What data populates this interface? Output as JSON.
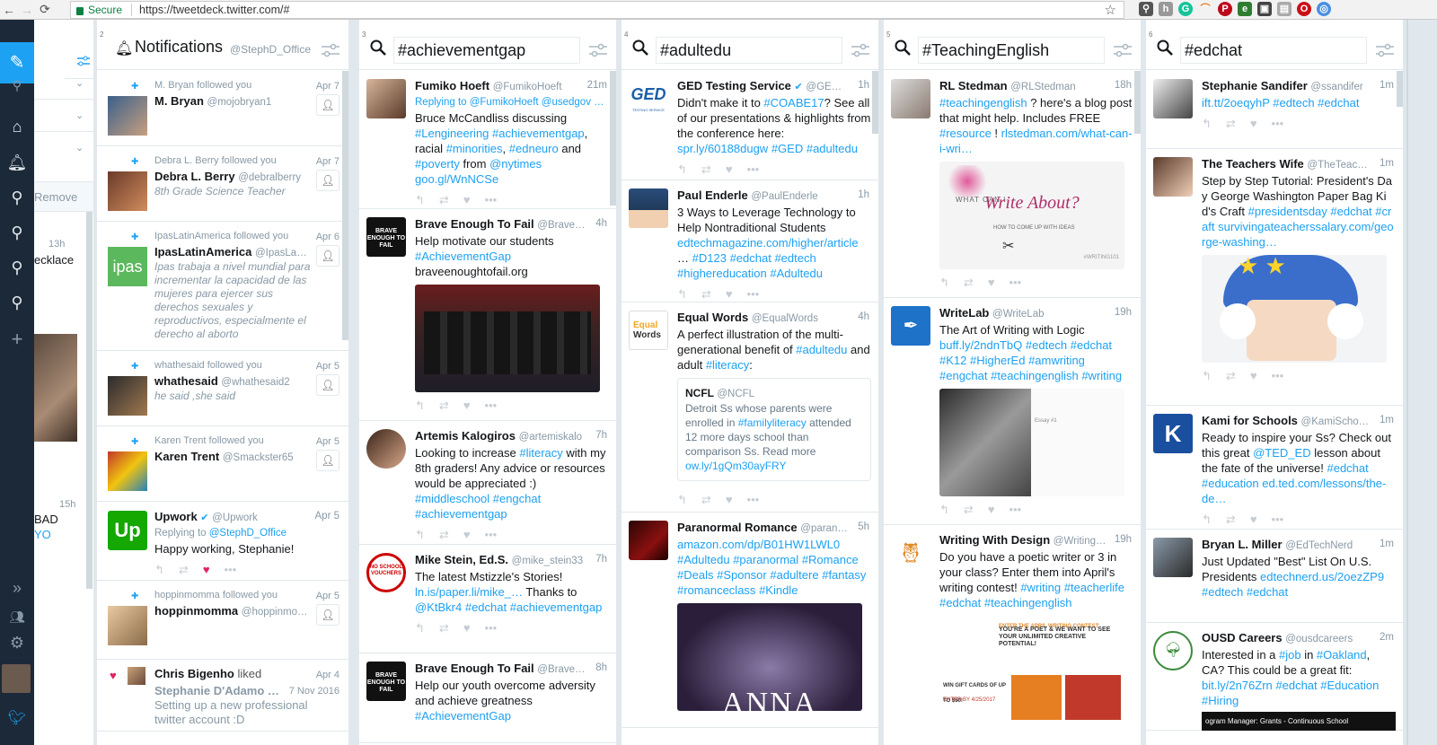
{
  "browser": {
    "secure_label": "Secure",
    "url": "https://tweetdeck.twitter.com/#"
  },
  "partial_column": {
    "lines": [
      "",
      "",
      ""
    ],
    "remove_label": "Remove",
    "time1": "13h",
    "snippet1": "ecklace",
    "time2": "15h",
    "snippet2": "BAD",
    "snippet3": "YO"
  },
  "columns": {
    "notifications": {
      "number": "2",
      "title": "Notifications",
      "account": "@StephD_Office",
      "items": [
        {
          "actor": "M. Bryan",
          "action": "followed you",
          "date": "Apr 7",
          "name": "M. Bryan",
          "handle": "@mojobryan1",
          "bio": ""
        },
        {
          "actor": "Debra L. Berry",
          "action": "followed you",
          "date": "Apr 7",
          "name": "Debra L. Berry",
          "handle": "@debralberry",
          "bio": "8th Grade Science Teacher"
        },
        {
          "actor": "IpasLatinAmerica",
          "action": "followed you",
          "date": "Apr 6",
          "name": "IpasLatinAmerica",
          "handle": "@IpasLa…",
          "bio": "Ipas trabaja a nivel mundial para incrementar la capacidad de las mujeres para ejercer sus derechos sexuales y reproductivos, especialmente el derecho al aborto"
        },
        {
          "actor": "whathesaid",
          "action": "followed you",
          "date": "Apr 5",
          "name": "whathesaid",
          "handle": "@whathesaid2",
          "bio": "he said ,she said"
        },
        {
          "actor": "Karen Trent",
          "action": "followed you",
          "date": "Apr 5",
          "name": "Karen Trent",
          "handle": "@Smackster65",
          "bio": ""
        }
      ],
      "upwork": {
        "name": "Upwork",
        "handle": "@Upwork",
        "date": "Apr 5",
        "reply_prefix": "Replying to",
        "reply_to": "@StephD_Office",
        "text": "Happy working, Stephanie!"
      },
      "hoppin": {
        "actor": "hoppinmomma",
        "action": "followed you",
        "date": "Apr 5",
        "name": "hoppinmomma",
        "handle": "@hoppinmo…"
      },
      "liked": {
        "actor": "Chris Bigenho",
        "action": "liked",
        "date": "Apr 4",
        "name": "Stephanie D'Adamo …",
        "date2": "7 Nov 2016",
        "text": "Setting up a new professional twitter account :D"
      }
    },
    "achievementgap": {
      "number": "3",
      "query": "#achievementgap",
      "tweets": [
        {
          "name": "Fumiko Hoeft",
          "handle": "@FumikoHoeft",
          "time": "21m",
          "reply": "Replying to @FumikoHoeft @usedgov …",
          "text": "Bruce McCandliss discussing #Lengineering #achievementgap, racial #minorities, #edneuro and #poverty from @nytimes goo.gl/WnNCSe"
        },
        {
          "name": "Brave Enough To Fail",
          "handle": "@Brave…",
          "time": "4h",
          "text": "Help motivate our students #AchievementGap braveenoughtofail.org"
        },
        {
          "name": "Artemis Kalogiros",
          "handle": "@artemiskalo",
          "time": "7h",
          "text": "Looking to increase #literacy with my 8th graders! Any advice or resources would be appreciated :) #middleschool #engchat #achievementgap"
        },
        {
          "name": "Mike Stein, Ed.S.",
          "handle": "@mike_stein33",
          "time": "7h",
          "text": "The latest Mstizzle's Stories! ln.is/paper.li/mike_… Thanks to @KtBkr4 #edchat #achievementgap"
        },
        {
          "name": "Brave Enough To Fail",
          "handle": "@Brave…",
          "time": "8h",
          "text": "Help our youth overcome adversity and achieve greatness #AchievementGap"
        }
      ],
      "brave_logo": "BRAVE ENOUGH TO FAIL",
      "nsv_logo": "NO SCHOOL VOUCHERS"
    },
    "adultedu": {
      "number": "4",
      "query": "#adultedu",
      "tweets": [
        {
          "name": "GED Testing Service",
          "handle": "@GE…",
          "time": "1h",
          "text": "Didn't make it to #COABE17? See all of our presentations & highlights from the conference here: spr.ly/60188dugw #GED #adultedu"
        },
        {
          "name": "Paul Enderle",
          "handle": "@PaulEnderle",
          "time": "1h",
          "text": "3 Ways to Leverage Technology to Help Nontraditional Students edtechmagazine.com/higher/article … #D123 #edchat #edtech #highereducation #Adultedu"
        },
        {
          "name": "Equal Words",
          "handle": "@EqualWords",
          "time": "4h",
          "text": "A perfect illustration of the multi-generational benefit of #adultedu and adult #literacy:"
        },
        {
          "name": "Paranormal Romance",
          "handle": "@paran…",
          "time": "5h",
          "text": "amazon.com/dp/B01HW1LWL0 #Adultedu #paranormal #Romance #Deals #Sponsor #adultere #fantasy #romanceclass #Kindle"
        }
      ],
      "quote": {
        "name": "NCFL",
        "handle": "@NCFL",
        "text": "Detroit Ss whose parents were enrolled in #familyliteracy attended 12 more days school than comparison Ss. Read more ow.ly/1gQm30ayFRY"
      },
      "ged_logo": "GED",
      "ged_sub": "TESTING SERVICE",
      "equal_logo1": "Equal",
      "equal_logo2": "Words",
      "book_title": "ANNA"
    },
    "teachingenglish": {
      "number": "5",
      "query": "#TeachingEnglish",
      "tweets": [
        {
          "name": "RL Stedman",
          "handle": "@RLStedman",
          "time": "18h",
          "text": "#teachingenglish ? here's a blog post that might help. Includes FREE #resource ! rlstedman.com/what-can-i-wri…"
        },
        {
          "name": "WriteLab",
          "handle": "@WriteLab",
          "time": "19h",
          "text": "The Art of Writing with Logic buff.ly/2ndnTbQ #edtech #edchat #K12 #HigherEd #amwriting #engchat #teachingenglish #writing"
        },
        {
          "name": "Writing With Design",
          "handle": "@Writing…",
          "time": "19h",
          "text": "Do you have a poetic writer or 3 in your class? Enter them into April's writing contest! #writing #teacherlife #edchat #teachingenglish"
        }
      ],
      "img1_a": "WHAT CAN I",
      "img1_b": "Write About?",
      "img1_c": "HOW TO COME UP WITH IDEAS",
      "img1_d": "#WRITING101",
      "img2_title": "Essay #1",
      "img3_a": "ENTER THE APRIL WRITING CONTEST:",
      "img3_b": "YOU'RE A POET & WE WANT TO SEE YOUR UNLIMITED CREATIVE POTENTIAL!",
      "img3_c": "WIN GIFT CARDS OF UP TO $50!",
      "img3_d": "ENTER BY 4/25/2017"
    },
    "edchat": {
      "number": "6",
      "query": "#edchat",
      "tweets": [
        {
          "name": "Stephanie Sandifer",
          "handle": "@ssandifer",
          "time": "1m",
          "text": "ift.tt/2oeqyhP #edtech #edchat"
        },
        {
          "name": "The Teachers Wife",
          "handle": "@TheTeac…",
          "time": "1m",
          "text": "Step by Step Tutorial: President's Day George Washington Paper Bag Kid's Craft #presidentsday #edchat #craft survivingateacherssalary.com/george-washing…"
        },
        {
          "name": "Kami for Schools",
          "handle": "@KamiScho…",
          "time": "1m",
          "text": "Ready to inspire your Ss? Check out this great @TED_ED lesson about the fate of the universe! #edchat #education ed.ted.com/lessons/the-de…"
        },
        {
          "name": "Bryan L. Miller",
          "handle": "@EdTechNerd",
          "time": "1m",
          "text": "Just Updated \"Best\" List On U.S. Presidents edtechnerd.us/2oezZP9 #edtech #edchat"
        },
        {
          "name": "OUSD Careers",
          "handle": "@ousdcareers",
          "time": "2m",
          "text": "Interested in a #job in #Oakland, CA? This could be a great fit: bit.ly/2n76Zrn #edchat #Education #Hiring"
        }
      ],
      "kami_logo": "K",
      "ousd_banner": "ogram Manager: Grants - Continuous School"
    }
  },
  "colors": {
    "accent": "#1da1f2",
    "nav_bg": "#1c2938",
    "like": "#e0245e"
  }
}
